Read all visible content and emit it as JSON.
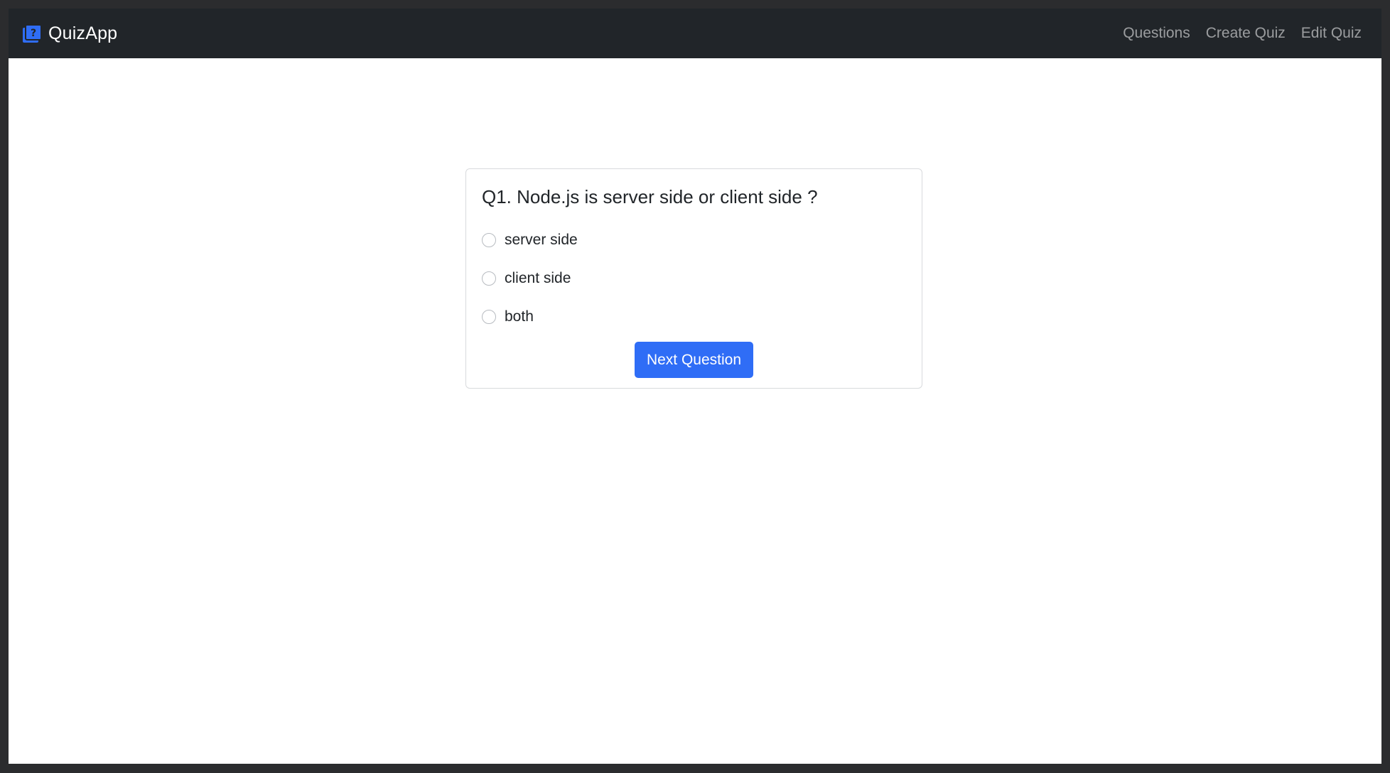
{
  "navbar": {
    "brand": "QuizApp",
    "brand_icon": "quiz-question-icon",
    "brand_icon_color": "#2f6df6",
    "links": [
      "Questions",
      "Create Quiz",
      "Edit Quiz"
    ]
  },
  "quiz": {
    "question": "Q1. Node.js is server side or client side ?",
    "options": [
      "server side",
      "client side",
      "both"
    ],
    "next_label": "Next Question",
    "accent_color": "#2f6df6"
  }
}
